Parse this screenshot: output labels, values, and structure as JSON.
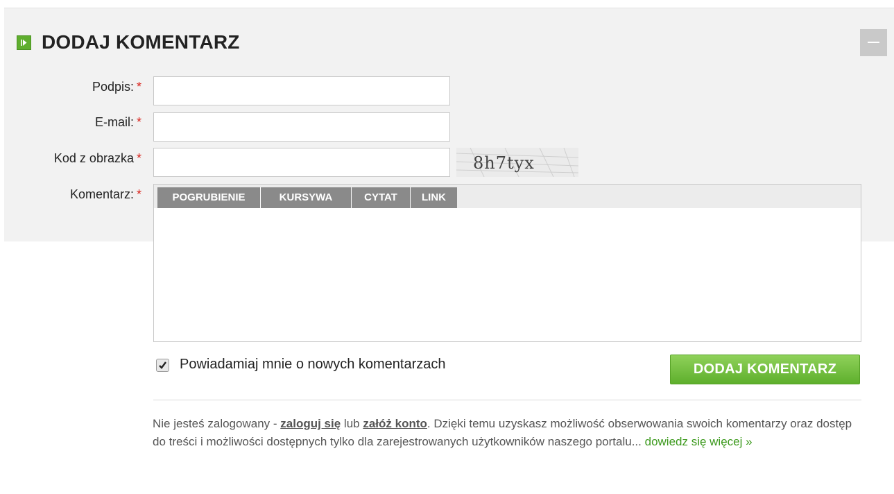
{
  "header": {
    "title": "DODAJ KOMENTARZ",
    "icon": "play-icon",
    "collapse_icon": "minus-icon"
  },
  "form": {
    "signature_label": "Podpis:",
    "email_label": "E-mail:",
    "captcha_label": "Kod z obrazka",
    "comment_label": "Komentarz:",
    "required_mark": "*",
    "signature_value": "",
    "email_value": "",
    "captcha_value": "",
    "comment_value": "",
    "captcha_text": "8h7tyx"
  },
  "toolbar": {
    "bold_label": "POGRUBIENIE",
    "italic_label": "KURSYWA",
    "quote_label": "CYTAT",
    "link_label": "LINK"
  },
  "notify": {
    "checked": true,
    "label": "Powiadamiaj mnie o nowych komentarzach"
  },
  "submit_label": "DODAJ KOMENTARZ",
  "info": {
    "text_before": "Nie jesteś zalogowany - ",
    "login_link": "zaloguj się",
    "text_or": " lub ",
    "register_link": "załóż konto",
    "text_after": ". Dzięki temu uzyskasz możliwość obserwowania swoich komentarzy oraz dostęp do treści i możliwości dostępnych tylko dla zarejestrowanych użytkowników naszego portalu... ",
    "more_link": "dowiedz się więcej »"
  },
  "colors": {
    "accent_green": "#5fae2e",
    "required_red": "#d9231c",
    "link_green": "#3d9a1e"
  }
}
